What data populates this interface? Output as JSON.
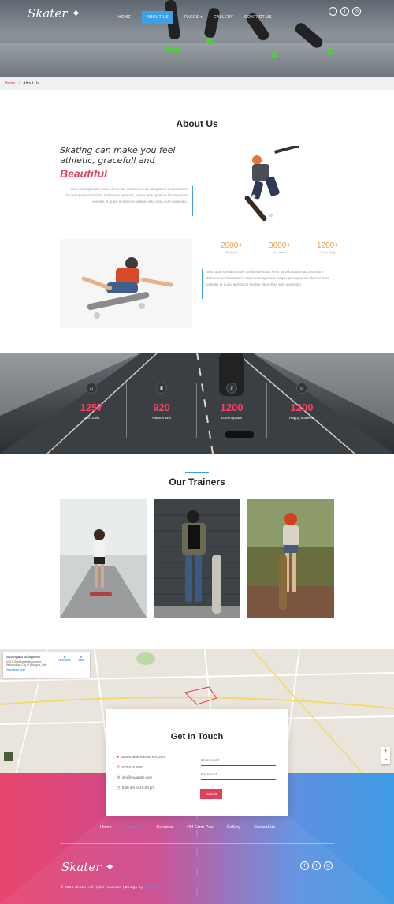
{
  "brand": {
    "logo_text": "Skater"
  },
  "nav": {
    "items": [
      "Home",
      "About Us",
      "Pages",
      "Gallery",
      "Contact Us"
    ],
    "pages_caret": "▾"
  },
  "social_icons": [
    "facebook-icon",
    "twitter-icon",
    "instagram-icon"
  ],
  "breadcrumb": {
    "home": "Home",
    "sep": "/",
    "current": "About Us"
  },
  "about": {
    "title": "About Us",
    "quote_line1": "Skating can make you feel",
    "quote_line2": "athletic, gracefull and",
    "quote_red": "Beautiful",
    "para1": "Sed ut perspiciatis unde omnis iste natus error sit voluptatem accusantium doloremque laudantium, totam rem aperiam, eaque ipsa quae ab illo inventore veritatis et quasi architecto beatae vitae dicta sunt explicabo.",
    "para2": "Sed ut perspiciatis unde omnis iste natus error sit voluptatem accusantium doloremque laudantium, totam rem aperiam, eaque ipsa quae ab illo inventore veritatis et quasi architecto beatae vitae dicta sunt explicabo.",
    "stats": [
      {
        "value": "2000+",
        "label": "Sit Amet"
      },
      {
        "value": "3600+",
        "label": "In Labore"
      },
      {
        "value": "1200+",
        "label": "Enim Mag"
      }
    ]
  },
  "counters": [
    {
      "icon": "home-icon",
      "glyph": "⌂",
      "value": "1257",
      "label": "Sed Doeis"
    },
    {
      "icon": "trophy-icon",
      "glyph": "♛",
      "value": "920",
      "label": "Awards Win"
    },
    {
      "icon": "key-icon",
      "glyph": "⚷",
      "value": "1200",
      "label": "Lorem Ipsum"
    },
    {
      "icon": "smile-icon",
      "glyph": "☺",
      "value": "1200",
      "label": "Happy Students"
    }
  ],
  "trainers": {
    "title": "Our Trainers"
  },
  "map": {
    "place_name": "Sant'Agata Bolognese",
    "address": "40019 Sant'Agata Bolognese, Metropolitan City of Bologna, Italy",
    "larger_map": "View larger map",
    "directions": "Directions",
    "save": "Save",
    "zoom_in": "+",
    "zoom_out": "−"
  },
  "contact": {
    "title": "Get In Touch",
    "address": "25095 Blue Ravine Rd,USA",
    "phone": "032 625 4592",
    "email": "info@example.com",
    "hours": "9.00 am to 10.00 pm",
    "email_placeholder": "Enter email",
    "password_placeholder": "Password",
    "submit": "Submit"
  },
  "footer": {
    "nav": [
      "Home",
      "About Us",
      "Services",
      "404 Error Pae",
      "Gallery",
      "Contact Us"
    ],
    "logo_text": "Skater",
    "copyright": "© 2018 Skater. All rights reserved | Design by",
    "designer": "W3layouts"
  },
  "colors": {
    "accent_blue": "#3aa0e8",
    "accent_red": "#e33e5a",
    "stat_orange": "#f0a04f"
  }
}
